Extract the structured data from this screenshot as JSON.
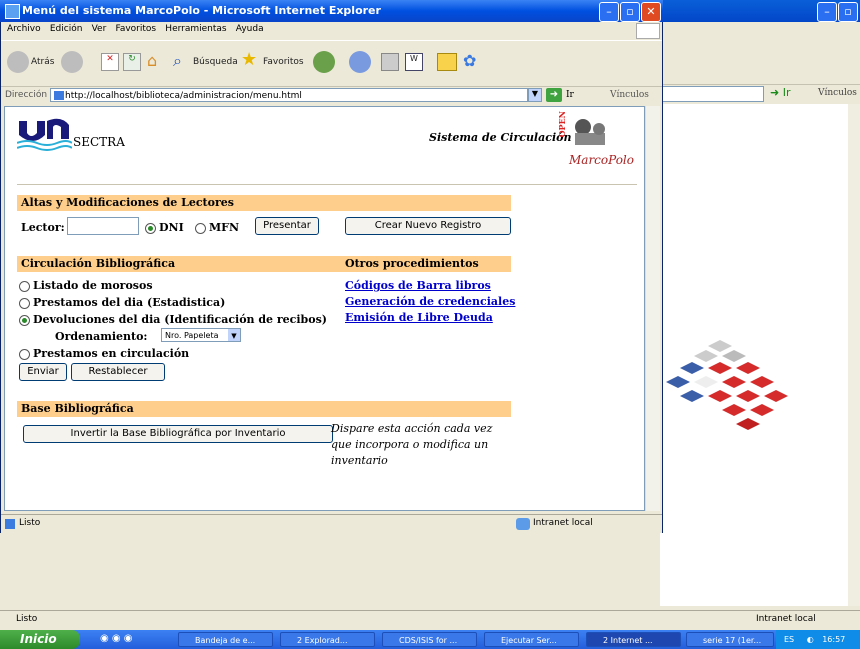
{
  "window": {
    "title": "Menú del sistema MarcoPolo - Microsoft Internet Explorer",
    "menu": [
      "Archivo",
      "Edición",
      "Ver",
      "Favoritos",
      "Herramientas",
      "Ayuda"
    ],
    "toolbar": {
      "back": "Atrás",
      "search": "Búsqueda",
      "favorites": "Favoritos"
    },
    "address_label": "Dirección",
    "address_value": "http://localhost/biblioteca/administracion/menu.html",
    "go_label": "Ir",
    "links_label": "Vínculos",
    "status_text": "Listo",
    "zone_text": "Intranet local"
  },
  "background_window": {
    "go_label": "Ir",
    "links_label": "Vínculos",
    "status_text": "Listo",
    "zone_text": "Intranet local"
  },
  "page": {
    "logo_text": "SECTRA",
    "system_title": "Sistema de Circulación",
    "marcopolo_open": "OPEN",
    "marcopolo_name": "MarcoPolo",
    "readers": {
      "header": "Altas y Modificaciones de Lectores",
      "lector_label": "Lector:",
      "lector_value": "",
      "opt_dni": "DNI",
      "opt_mfn": "MFN",
      "present_button": "Presentar",
      "new_record_button": "Crear Nuevo Registro"
    },
    "circulation": {
      "header": "Circulación Bibliográfica",
      "opt1": "Listado de morosos",
      "opt2": "Prestamos del dia (Estadistica)",
      "opt3": "Devoluciones del dia (Identificación de recibos)",
      "order_label": "Ordenamiento:",
      "order_value": "Nro. Papeleta",
      "opt4": "Prestamos en circulación",
      "send_button": "Enviar",
      "reset_button": "Restablecer"
    },
    "other": {
      "header": "Otros procedimientos",
      "link1": "Códigos de Barra libros",
      "link2": "Generación de credenciales",
      "link3": "Emisión de Libre Deuda"
    },
    "base": {
      "header": "Base Bibliográfica",
      "invert_button": "Invertir la Base Bibliográfica por Inventario",
      "note": "Dispare esta acción cada vez que incorpora o modifica un inventario"
    }
  },
  "taskbar": {
    "start": "Inicio",
    "tasks": [
      "Bandeja de e...",
      "2 Explorad...",
      "CDS/ISIS for ...",
      "Ejecutar Ser...",
      "2 Internet ...",
      "serie 17 (1er..."
    ],
    "lang": "ES",
    "clock": "16:57"
  }
}
